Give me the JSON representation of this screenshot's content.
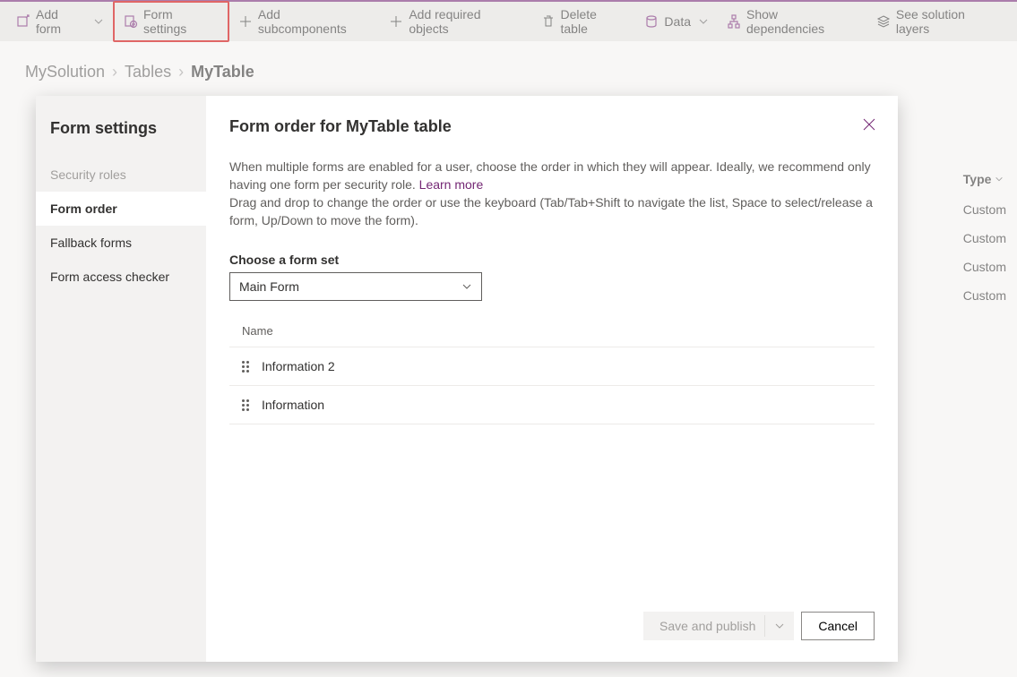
{
  "toolbar": {
    "add_form": "Add form",
    "form_settings": "Form settings",
    "add_subcomponents": "Add subcomponents",
    "add_required_objects": "Add required objects",
    "delete_table": "Delete table",
    "data": "Data",
    "show_dependencies": "Show dependencies",
    "see_solution_layers": "See solution layers"
  },
  "breadcrumb": {
    "solution": "MySolution",
    "tables": "Tables",
    "current": "MyTable"
  },
  "background_table": {
    "type_header": "Type",
    "type_values": [
      "Custom",
      "Custom",
      "Custom",
      "Custom"
    ]
  },
  "modal": {
    "sidebar_title": "Form settings",
    "nav": {
      "security_roles": "Security roles",
      "form_order": "Form order",
      "fallback_forms": "Fallback forms",
      "form_access_checker": "Form access checker"
    },
    "title": "Form order for MyTable table",
    "description_1": "When multiple forms are enabled for a user, choose the order in which they will appear. Ideally, we recommend only having one form per security role. ",
    "learn_more": "Learn more",
    "description_2": "Drag and drop to change the order or use the keyboard (Tab/Tab+Shift to navigate the list, Space to select/release a form, Up/Down to move the form).",
    "choose_label": "Choose a form set",
    "form_set_selected": "Main Form",
    "list_header": "Name",
    "items": [
      "Information 2",
      "Information"
    ],
    "save_publish": "Save and publish",
    "cancel": "Cancel"
  }
}
